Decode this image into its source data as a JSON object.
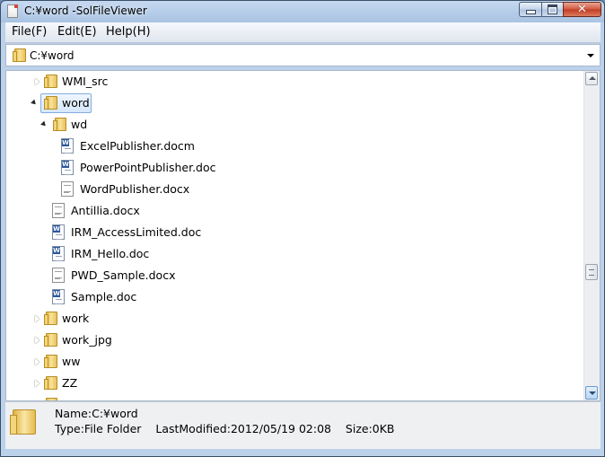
{
  "window": {
    "title": "C:¥word -SolFileViewer"
  },
  "menu": {
    "items": [
      "File(F)",
      "Edit(E)",
      "Help(H)"
    ]
  },
  "path": {
    "value": "C:¥word"
  },
  "tree": {
    "items": [
      {
        "label": "WMI_src",
        "type": "folder",
        "expander": "collapsed"
      },
      {
        "label": "word",
        "type": "folder",
        "expander": "expanded",
        "selected": true
      },
      {
        "label": "wd",
        "type": "folder",
        "expander": "expanded"
      },
      {
        "label": "ExcelPublisher.docm",
        "type": "word-file"
      },
      {
        "label": "PowerPointPublisher.doc",
        "type": "word-file"
      },
      {
        "label": "WordPublisher.docx",
        "type": "text-file"
      },
      {
        "label": "Antillia.docx",
        "type": "text-file"
      },
      {
        "label": "IRM_AccessLimited.doc",
        "type": "word-file"
      },
      {
        "label": "IRM_Hello.doc",
        "type": "word-file"
      },
      {
        "label": "PWD_Sample.docx",
        "type": "text-file"
      },
      {
        "label": "Sample.doc",
        "type": "word-file"
      },
      {
        "label": "work",
        "type": "folder",
        "expander": "collapsed"
      },
      {
        "label": "work_jpg",
        "type": "folder",
        "expander": "collapsed"
      },
      {
        "label": "ww",
        "type": "folder",
        "expander": "collapsed"
      },
      {
        "label": "ZZ",
        "type": "folder",
        "expander": "collapsed"
      }
    ]
  },
  "status": {
    "name": "Name:C:¥word",
    "type": "Type:File Folder",
    "last_modified": "LastModified:2012/05/19 02:08",
    "size": "Size:0KB"
  }
}
